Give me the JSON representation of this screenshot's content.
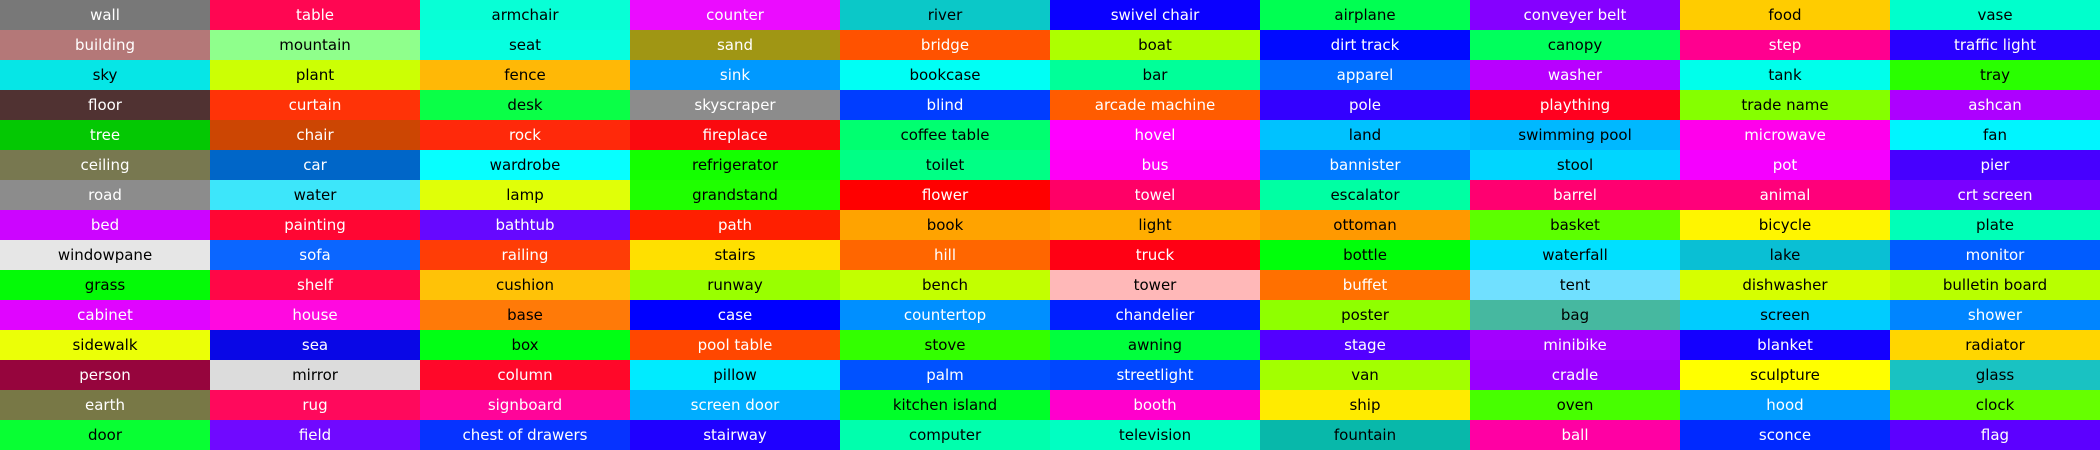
{
  "cells": [
    {
      "label": "wall",
      "color": "#787878",
      "text": "#ffffff"
    },
    {
      "label": "building",
      "color": "#b47878",
      "text": "#ffffff"
    },
    {
      "label": "sky",
      "color": "#06e6e6",
      "text": "#000000"
    },
    {
      "label": "floor",
      "color": "#503232",
      "text": "#ffffff"
    },
    {
      "label": "tree",
      "color": "#04c803",
      "text": "#ffffff"
    },
    {
      "label": "ceiling",
      "color": "#787850",
      "text": "#ffffff"
    },
    {
      "label": "road",
      "color": "#8c8c8c",
      "text": "#ffffff"
    },
    {
      "label": "bed",
      "color": "#cc05ff",
      "text": "#ffffff"
    },
    {
      "label": "windowpane",
      "color": "#e6e6e6",
      "text": "#000000"
    },
    {
      "label": "grass",
      "color": "#04fa07",
      "text": "#000000"
    },
    {
      "label": "cabinet",
      "color": "#e005ff",
      "text": "#ffffff"
    },
    {
      "label": "sidewalk",
      "color": "#ebff07",
      "text": "#000000"
    },
    {
      "label": "person",
      "color": "#96053d",
      "text": "#ffffff"
    },
    {
      "label": "earth",
      "color": "#787846",
      "text": "#ffffff"
    },
    {
      "label": "door",
      "color": "#08ff33",
      "text": "#000000"
    },
    {
      "label": "table",
      "color": "#ff0652",
      "text": "#ffffff"
    },
    {
      "label": "mountain",
      "color": "#8fff8c",
      "text": "#000000"
    },
    {
      "label": "plant",
      "color": "#ccff04",
      "text": "#000000"
    },
    {
      "label": "curtain",
      "color": "#ff3307",
      "text": "#ffffff"
    },
    {
      "label": "chair",
      "color": "#cc4603",
      "text": "#ffffff"
    },
    {
      "label": "car",
      "color": "#0066c8",
      "text": "#ffffff"
    },
    {
      "label": "water",
      "color": "#3de6fa",
      "text": "#000000"
    },
    {
      "label": "painting",
      "color": "#ff0633",
      "text": "#ffffff"
    },
    {
      "label": "sofa",
      "color": "#0b66ff",
      "text": "#ffffff"
    },
    {
      "label": "shelf",
      "color": "#ff0747",
      "text": "#ffffff"
    },
    {
      "label": "house",
      "color": "#ff09e0",
      "text": "#ffffff"
    },
    {
      "label": "sea",
      "color": "#0907e6",
      "text": "#ffffff"
    },
    {
      "label": "mirror",
      "color": "#dcdcdc",
      "text": "#000000"
    },
    {
      "label": "rug",
      "color": "#ff095c",
      "text": "#ffffff"
    },
    {
      "label": "field",
      "color": "#7009ff",
      "text": "#ffffff"
    },
    {
      "label": "armchair",
      "color": "#08ffd6",
      "text": "#000000"
    },
    {
      "label": "seat",
      "color": "#07ffe0",
      "text": "#000000"
    },
    {
      "label": "fence",
      "color": "#ffb806",
      "text": "#000000"
    },
    {
      "label": "desk",
      "color": "#0aff47",
      "text": "#000000"
    },
    {
      "label": "rock",
      "color": "#ff290a",
      "text": "#ffffff"
    },
    {
      "label": "wardrobe",
      "color": "#07ffff",
      "text": "#000000"
    },
    {
      "label": "lamp",
      "color": "#e0ff08",
      "text": "#000000"
    },
    {
      "label": "bathtub",
      "color": "#6608ff",
      "text": "#ffffff"
    },
    {
      "label": "railing",
      "color": "#ff3d06",
      "text": "#ffffff"
    },
    {
      "label": "cushion",
      "color": "#ffc207",
      "text": "#000000"
    },
    {
      "label": "base",
      "color": "#ff7a08",
      "text": "#000000"
    },
    {
      "label": "box",
      "color": "#00ff14",
      "text": "#000000"
    },
    {
      "label": "column",
      "color": "#ff0829",
      "text": "#ffffff"
    },
    {
      "label": "signboard",
      "color": "#ff0599",
      "text": "#ffffff"
    },
    {
      "label": "chest of drawers",
      "color": "#0633ff",
      "text": "#ffffff"
    },
    {
      "label": "counter",
      "color": "#eb0cff",
      "text": "#ffffff"
    },
    {
      "label": "sand",
      "color": "#a09614",
      "text": "#ffffff"
    },
    {
      "label": "sink",
      "color": "#0099ff",
      "text": "#ffffff"
    },
    {
      "label": "skyscraper",
      "color": "#8c8c8c",
      "text": "#ffffff"
    },
    {
      "label": "fireplace",
      "color": "#fa0a0f",
      "text": "#ffffff"
    },
    {
      "label": "refrigerator",
      "color": "#14ff00",
      "text": "#000000"
    },
    {
      "label": "grandstand",
      "color": "#1fff00",
      "text": "#000000"
    },
    {
      "label": "path",
      "color": "#ff1f00",
      "text": "#ffffff"
    },
    {
      "label": "stairs",
      "color": "#ffe000",
      "text": "#000000"
    },
    {
      "label": "runway",
      "color": "#99ff00",
      "text": "#000000"
    },
    {
      "label": "case",
      "color": "#0000ff",
      "text": "#ffffff"
    },
    {
      "label": "pool table",
      "color": "#ff4700",
      "text": "#ffffff"
    },
    {
      "label": "pillow",
      "color": "#00ebff",
      "text": "#000000"
    },
    {
      "label": "screen door",
      "color": "#00adff",
      "text": "#ffffff"
    },
    {
      "label": "stairway",
      "color": "#1f00ff",
      "text": "#ffffff"
    },
    {
      "label": "river",
      "color": "#0bc8c8",
      "text": "#000000"
    },
    {
      "label": "bridge",
      "color": "#ff5200",
      "text": "#ffffff"
    },
    {
      "label": "bookcase",
      "color": "#00fff5",
      "text": "#000000"
    },
    {
      "label": "blind",
      "color": "#003dff",
      "text": "#ffffff"
    },
    {
      "label": "coffee table",
      "color": "#00ff70",
      "text": "#000000"
    },
    {
      "label": "toilet",
      "color": "#00ff85",
      "text": "#000000"
    },
    {
      "label": "flower",
      "color": "#ff0000",
      "text": "#ffffff"
    },
    {
      "label": "book",
      "color": "#ffa300",
      "text": "#000000"
    },
    {
      "label": "hill",
      "color": "#ff6600",
      "text": "#ffffff"
    },
    {
      "label": "bench",
      "color": "#c2ff00",
      "text": "#000000"
    },
    {
      "label": "countertop",
      "color": "#008fff",
      "text": "#ffffff"
    },
    {
      "label": "stove",
      "color": "#33ff00",
      "text": "#000000"
    },
    {
      "label": "palm",
      "color": "#0052ff",
      "text": "#ffffff"
    },
    {
      "label": "kitchen island",
      "color": "#00ff29",
      "text": "#000000"
    },
    {
      "label": "computer",
      "color": "#00ffad",
      "text": "#000000"
    },
    {
      "label": "swivel chair",
      "color": "#0a00ff",
      "text": "#ffffff"
    },
    {
      "label": "boat",
      "color": "#adff00",
      "text": "#000000"
    },
    {
      "label": "bar",
      "color": "#00ff99",
      "text": "#000000"
    },
    {
      "label": "arcade machine",
      "color": "#ff5c00",
      "text": "#ffffff"
    },
    {
      "label": "hovel",
      "color": "#ff00ff",
      "text": "#ffffff"
    },
    {
      "label": "bus",
      "color": "#ff00f5",
      "text": "#ffffff"
    },
    {
      "label": "towel",
      "color": "#ff0066",
      "text": "#ffffff"
    },
    {
      "label": "light",
      "color": "#ffad00",
      "text": "#000000"
    },
    {
      "label": "truck",
      "color": "#ff0014",
      "text": "#ffffff"
    },
    {
      "label": "tower",
      "color": "#ffb8b8",
      "text": "#000000"
    },
    {
      "label": "chandelier",
      "color": "#001fff",
      "text": "#ffffff"
    },
    {
      "label": "awning",
      "color": "#00ff3d",
      "text": "#000000"
    },
    {
      "label": "streetlight",
      "color": "#0047ff",
      "text": "#ffffff"
    },
    {
      "label": "booth",
      "color": "#ff00cc",
      "text": "#ffffff"
    },
    {
      "label": "television",
      "color": "#00ffc2",
      "text": "#000000"
    },
    {
      "label": "airplane",
      "color": "#00ff52",
      "text": "#000000"
    },
    {
      "label": "dirt track",
      "color": "#000aff",
      "text": "#ffffff"
    },
    {
      "label": "apparel",
      "color": "#0070ff",
      "text": "#ffffff"
    },
    {
      "label": "pole",
      "color": "#3300ff",
      "text": "#ffffff"
    },
    {
      "label": "land",
      "color": "#00c2ff",
      "text": "#000000"
    },
    {
      "label": "bannister",
      "color": "#007aff",
      "text": "#ffffff"
    },
    {
      "label": "escalator",
      "color": "#00ffa3",
      "text": "#000000"
    },
    {
      "label": "ottoman",
      "color": "#ff9900",
      "text": "#000000"
    },
    {
      "label": "bottle",
      "color": "#00ff0a",
      "text": "#000000"
    },
    {
      "label": "buffet",
      "color": "#ff7000",
      "text": "#ffffff"
    },
    {
      "label": "poster",
      "color": "#8fff00",
      "text": "#000000"
    },
    {
      "label": "stage",
      "color": "#5200ff",
      "text": "#ffffff"
    },
    {
      "label": "van",
      "color": "#a3ff00",
      "text": "#000000"
    },
    {
      "label": "ship",
      "color": "#ffeb00",
      "text": "#000000"
    },
    {
      "label": "fountain",
      "color": "#08b8aa",
      "text": "#000000"
    },
    {
      "label": "conveyer belt",
      "color": "#8500ff",
      "text": "#ffffff"
    },
    {
      "label": "canopy",
      "color": "#00ff5c",
      "text": "#000000"
    },
    {
      "label": "washer",
      "color": "#b800ff",
      "text": "#ffffff"
    },
    {
      "label": "plaything",
      "color": "#ff001f",
      "text": "#ffffff"
    },
    {
      "label": "swimming pool",
      "color": "#00b8ff",
      "text": "#000000"
    },
    {
      "label": "stool",
      "color": "#00d6ff",
      "text": "#000000"
    },
    {
      "label": "barrel",
      "color": "#ff0070",
      "text": "#ffffff"
    },
    {
      "label": "basket",
      "color": "#5cff00",
      "text": "#000000"
    },
    {
      "label": "waterfall",
      "color": "#00e0ff",
      "text": "#000000"
    },
    {
      "label": "tent",
      "color": "#70e0ff",
      "text": "#000000"
    },
    {
      "label": "bag",
      "color": "#46b8a0",
      "text": "#000000"
    },
    {
      "label": "minibike",
      "color": "#a300ff",
      "text": "#ffffff"
    },
    {
      "label": "cradle",
      "color": "#9900ff",
      "text": "#ffffff"
    },
    {
      "label": "oven",
      "color": "#47ff00",
      "text": "#000000"
    },
    {
      "label": "ball",
      "color": "#ff00a3",
      "text": "#ffffff"
    },
    {
      "label": "food",
      "color": "#ffcc00",
      "text": "#000000"
    },
    {
      "label": "step",
      "color": "#ff008f",
      "text": "#ffffff"
    },
    {
      "label": "tank",
      "color": "#00ffeb",
      "text": "#000000"
    },
    {
      "label": "trade name",
      "color": "#85ff00",
      "text": "#000000"
    },
    {
      "label": "microwave",
      "color": "#ff00eb",
      "text": "#ffffff"
    },
    {
      "label": "pot",
      "color": "#f500ff",
      "text": "#ffffff"
    },
    {
      "label": "animal",
      "color": "#ff007a",
      "text": "#ffffff"
    },
    {
      "label": "bicycle",
      "color": "#fff500",
      "text": "#000000"
    },
    {
      "label": "lake",
      "color": "#0abfd4",
      "text": "#000000"
    },
    {
      "label": "dishwasher",
      "color": "#d6ff00",
      "text": "#000000"
    },
    {
      "label": "screen",
      "color": "#00ccff",
      "text": "#000000"
    },
    {
      "label": "blanket",
      "color": "#1400ff",
      "text": "#ffffff"
    },
    {
      "label": "sculpture",
      "color": "#ffff00",
      "text": "#000000"
    },
    {
      "label": "hood",
      "color": "#0099ff",
      "text": "#ffffff"
    },
    {
      "label": "sconce",
      "color": "#0029ff",
      "text": "#ffffff"
    },
    {
      "label": "vase",
      "color": "#00ffcc",
      "text": "#000000"
    },
    {
      "label": "traffic light",
      "color": "#2900ff",
      "text": "#ffffff"
    },
    {
      "label": "tray",
      "color": "#29ff00",
      "text": "#000000"
    },
    {
      "label": "ashcan",
      "color": "#ad00ff",
      "text": "#ffffff"
    },
    {
      "label": "fan",
      "color": "#00f5ff",
      "text": "#000000"
    },
    {
      "label": "pier",
      "color": "#4700ff",
      "text": "#ffffff"
    },
    {
      "label": "crt screen",
      "color": "#7a00ff",
      "text": "#ffffff"
    },
    {
      "label": "plate",
      "color": "#00ffb8",
      "text": "#000000"
    },
    {
      "label": "monitor",
      "color": "#005cff",
      "text": "#ffffff"
    },
    {
      "label": "bulletin board",
      "color": "#b8ff00",
      "text": "#000000"
    },
    {
      "label": "shower",
      "color": "#0085ff",
      "text": "#ffffff"
    },
    {
      "label": "radiator",
      "color": "#ffd600",
      "text": "#000000"
    },
    {
      "label": "glass",
      "color": "#19c2c2",
      "text": "#000000"
    },
    {
      "label": "clock",
      "color": "#66ff00",
      "text": "#000000"
    },
    {
      "label": "flag",
      "color": "#5c00ff",
      "text": "#ffffff"
    }
  ]
}
